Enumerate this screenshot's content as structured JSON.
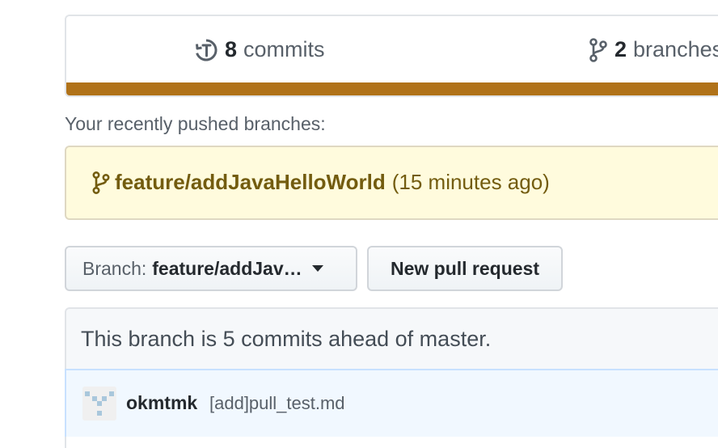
{
  "summary": {
    "commits_count": "8",
    "commits_label": "commits",
    "branches_count": "2",
    "branches_label": "branches",
    "language_color": "#b07219"
  },
  "recent": {
    "label": "Your recently pushed branches:",
    "branch_name": "feature/addJavaHelloWorld",
    "time_ago": "(15 minutes ago)"
  },
  "toolbar": {
    "branch_prefix": "Branch:",
    "branch_value": "feature/addJav…",
    "new_pr_label": "New pull request"
  },
  "branch_status": {
    "text": "This branch is 5 commits ahead of master."
  },
  "latest_commit": {
    "author": "okmtmk",
    "message": "[add]pull_test.md"
  },
  "icons": {
    "commits": "history-icon",
    "branches": "git-branch-icon",
    "recent_branch": "git-branch-icon",
    "branch_dropdown": "caret-down-icon"
  }
}
